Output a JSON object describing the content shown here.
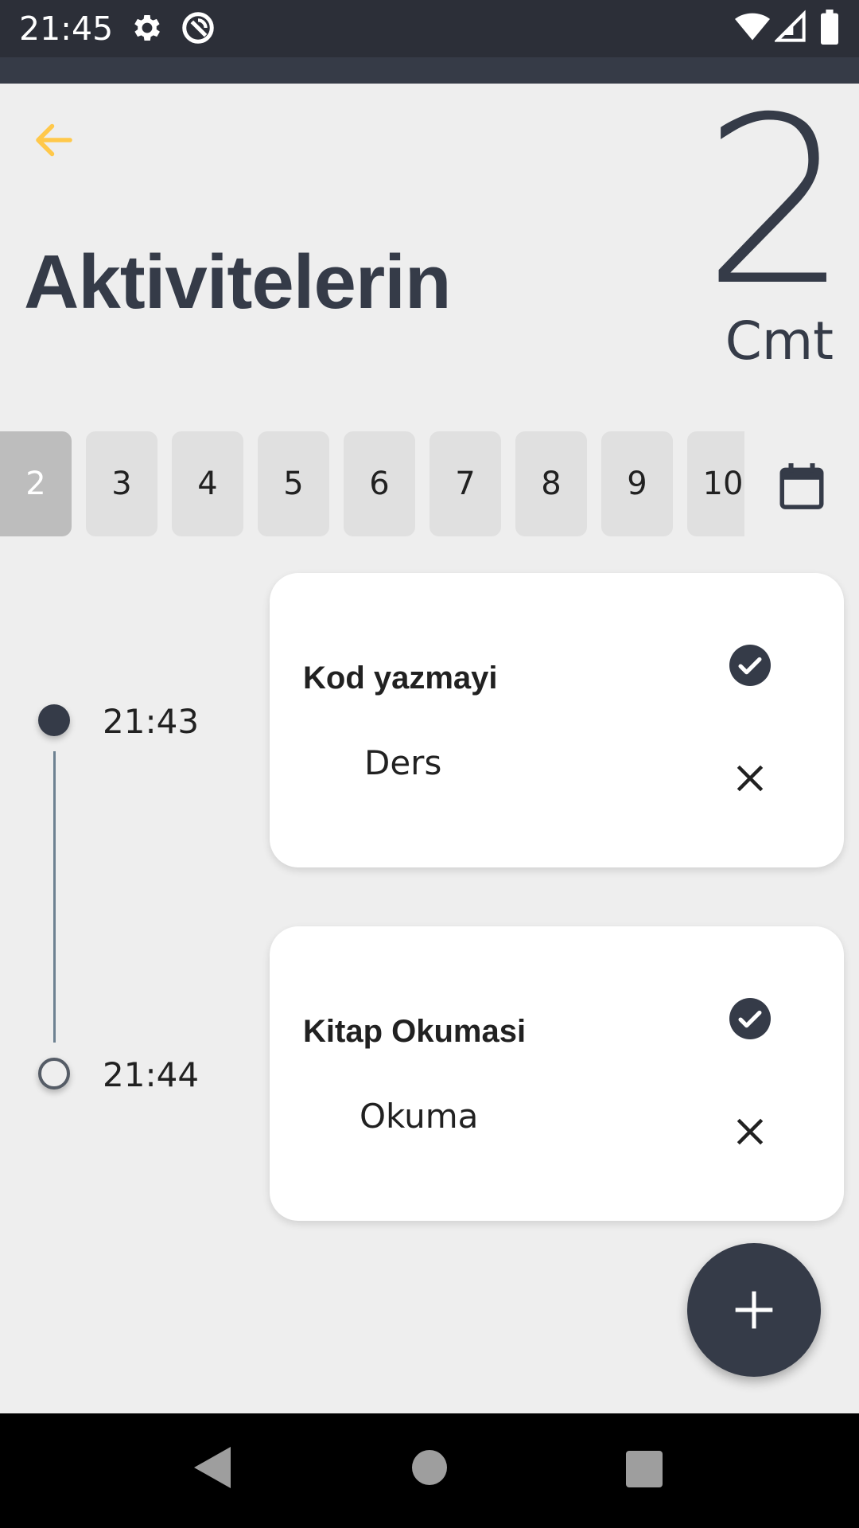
{
  "status_bar": {
    "time": "21:45",
    "icons": [
      "gear-icon",
      "sync-off-icon",
      "wifi-icon",
      "signal-icon",
      "battery-icon"
    ]
  },
  "header": {
    "title": "Aktivitelerin",
    "day_number": "2",
    "day_name": "Cmt",
    "accent_color": "#FFC84A"
  },
  "day_strip": {
    "selected": "2",
    "days": [
      "2",
      "3",
      "4",
      "5",
      "6",
      "7",
      "8",
      "9",
      "10"
    ]
  },
  "timeline": [
    {
      "time": "21:43",
      "completed": true
    },
    {
      "time": "21:44",
      "completed": false
    }
  ],
  "activities": [
    {
      "title": "Kod yazmayi",
      "category": "Ders"
    },
    {
      "title": "Kitap Okumasi",
      "category": "Okuma"
    }
  ],
  "colors": {
    "primary_dark": "#353B48",
    "background": "#EEEEEE",
    "chip": "#E0E0E0",
    "chip_selected": "#BDBDBD"
  }
}
